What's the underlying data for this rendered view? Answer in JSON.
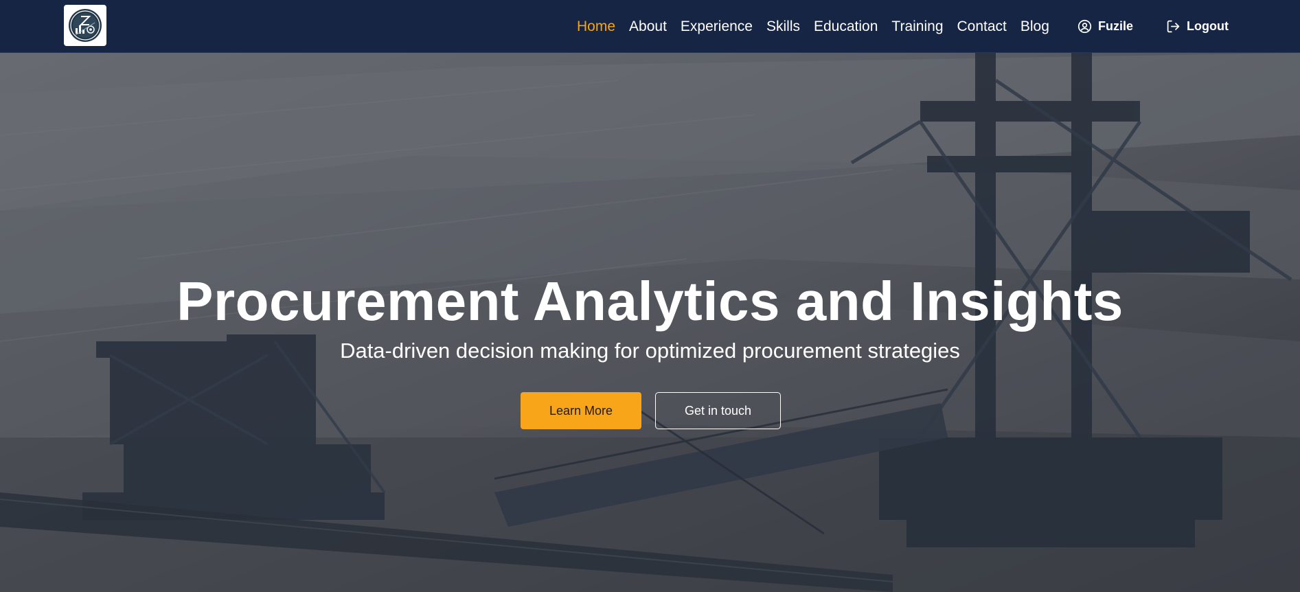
{
  "nav": {
    "links": [
      {
        "label": "Home",
        "active": true
      },
      {
        "label": "About",
        "active": false
      },
      {
        "label": "Experience",
        "active": false
      },
      {
        "label": "Skills",
        "active": false
      },
      {
        "label": "Education",
        "active": false
      },
      {
        "label": "Training",
        "active": false
      },
      {
        "label": "Contact",
        "active": false
      },
      {
        "label": "Blog",
        "active": false
      }
    ],
    "user": {
      "icon": "user-circle-icon",
      "label": "Fuzile"
    },
    "logout": {
      "icon": "logout-icon",
      "label": "Logout"
    }
  },
  "logo": {
    "icon": "logo-emblem-icon"
  },
  "hero": {
    "title": "Procurement Analytics and Insights",
    "subtitle": "Data-driven decision making for optimized procurement strategies",
    "primary_button": "Learn More",
    "secondary_button": "Get in touch",
    "background": "mining-excavator-photo"
  },
  "colors": {
    "navbar": "#162544",
    "accent": "#f4a51c",
    "button_primary": "#f8a51a",
    "text": "#ffffff"
  }
}
